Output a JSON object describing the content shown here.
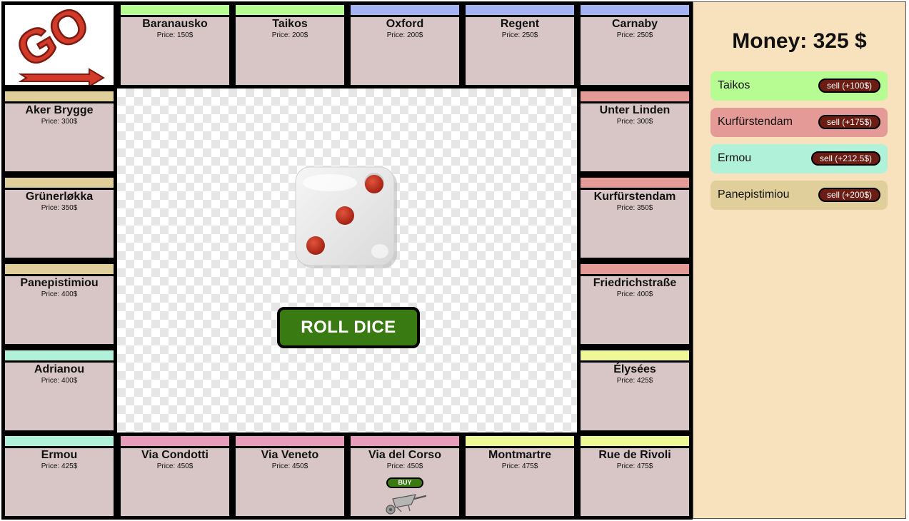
{
  "board": {
    "go_label": "GO",
    "top_row": [
      {
        "name": "Baranausko",
        "price": "Price: 150$",
        "color": "#b7fb93"
      },
      {
        "name": "Taikos",
        "price": "Price: 200$",
        "color": "#b7fb93"
      },
      {
        "name": "Oxford",
        "price": "Price: 200$",
        "color": "#a5b3f4"
      },
      {
        "name": "Regent",
        "price": "Price: 250$",
        "color": "#a5b3f4"
      },
      {
        "name": "Carnaby",
        "price": "Price: 250$",
        "color": "#a5b3f4"
      }
    ],
    "left_col": [
      {
        "name": "Aker Brygge",
        "price": "Price: 300$",
        "color": "#e0cf9b"
      },
      {
        "name": "Grünerløkka",
        "price": "Price: 350$",
        "color": "#e0cf9b"
      },
      {
        "name": "Panepistimiou",
        "price": "Price: 400$",
        "color": "#e0cf9b"
      },
      {
        "name": "Adrianou",
        "price": "Price: 400$",
        "color": "#b0f2d9"
      }
    ],
    "right_col": [
      {
        "name": "Unter Linden",
        "price": "Price: 300$",
        "color": "#e49b97"
      },
      {
        "name": "Kurfürstendam",
        "price": "Price: 350$",
        "color": "#e49b97"
      },
      {
        "name": "Friedrichstraße",
        "price": "Price: 400$",
        "color": "#e49b97"
      },
      {
        "name": "Élysées",
        "price": "Price: 425$",
        "color": "#eff896"
      }
    ],
    "bottom_row": [
      {
        "name": "Ermou",
        "price": "Price: 425$",
        "color": "#b0f2d9"
      },
      {
        "name": "Via Condotti",
        "price": "Price: 450$",
        "color": "#e79cbc"
      },
      {
        "name": "Via Veneto",
        "price": "Price: 450$",
        "color": "#e79cbc"
      },
      {
        "name": "Via del Corso",
        "price": "Price: 450$",
        "color": "#e79cbc",
        "buy_label": "BUY",
        "token": "wheelbarrow-token"
      },
      {
        "name": "Montmartre",
        "price": "Price: 475$",
        "color": "#eff896"
      },
      {
        "name": "Rue de Rivoli",
        "price": "Price: 475$",
        "color": "#eff896"
      }
    ],
    "dice_value": 3,
    "roll_label": "ROLL DICE"
  },
  "sidebar": {
    "money": "Money: 325 $",
    "owned": [
      {
        "name": "Taikos",
        "sell_label": "sell (+100$)",
        "color": "#b7fb93"
      },
      {
        "name": "Kurfürstendam",
        "sell_label": "sell (+175$)",
        "color": "#e49b97"
      },
      {
        "name": "Ermou",
        "sell_label": "sell (+212.5$)",
        "color": "#b0f2d9"
      },
      {
        "name": "Panepistimiou",
        "sell_label": "sell (+200$)",
        "color": "#e0cf9b"
      }
    ]
  }
}
